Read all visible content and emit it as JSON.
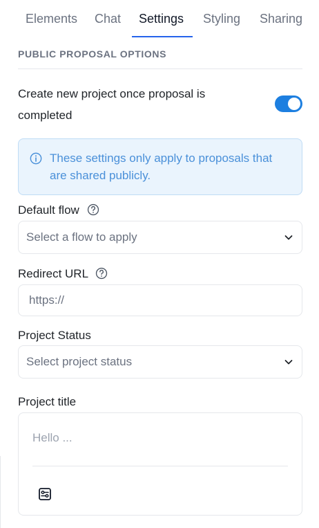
{
  "tabs": [
    {
      "label": "Elements"
    },
    {
      "label": "Chat"
    },
    {
      "label": "Settings",
      "active": true
    },
    {
      "label": "Styling"
    },
    {
      "label": "Sharing"
    }
  ],
  "section": {
    "title": "PUBLIC PROPOSAL OPTIONS"
  },
  "create_project": {
    "label": "Create new project once proposal is completed",
    "enabled": true
  },
  "info": {
    "text": "These settings only apply to proposals that are shared publicly.",
    "icon": "info-circle-icon"
  },
  "default_flow": {
    "label": "Default flow",
    "placeholder": "Select a flow to apply"
  },
  "redirect_url": {
    "label": "Redirect URL",
    "value": "https://"
  },
  "project_status": {
    "label": "Project Status",
    "placeholder": "Select project status"
  },
  "project_title": {
    "label": "Project title",
    "placeholder": "Hello ...",
    "tool_icon": "variable-icon"
  },
  "colors": {
    "accent": "#2563eb",
    "toggle_on": "#1d7fe0",
    "info_bg": "#eaf4fd",
    "info_text": "#4a90d9"
  }
}
